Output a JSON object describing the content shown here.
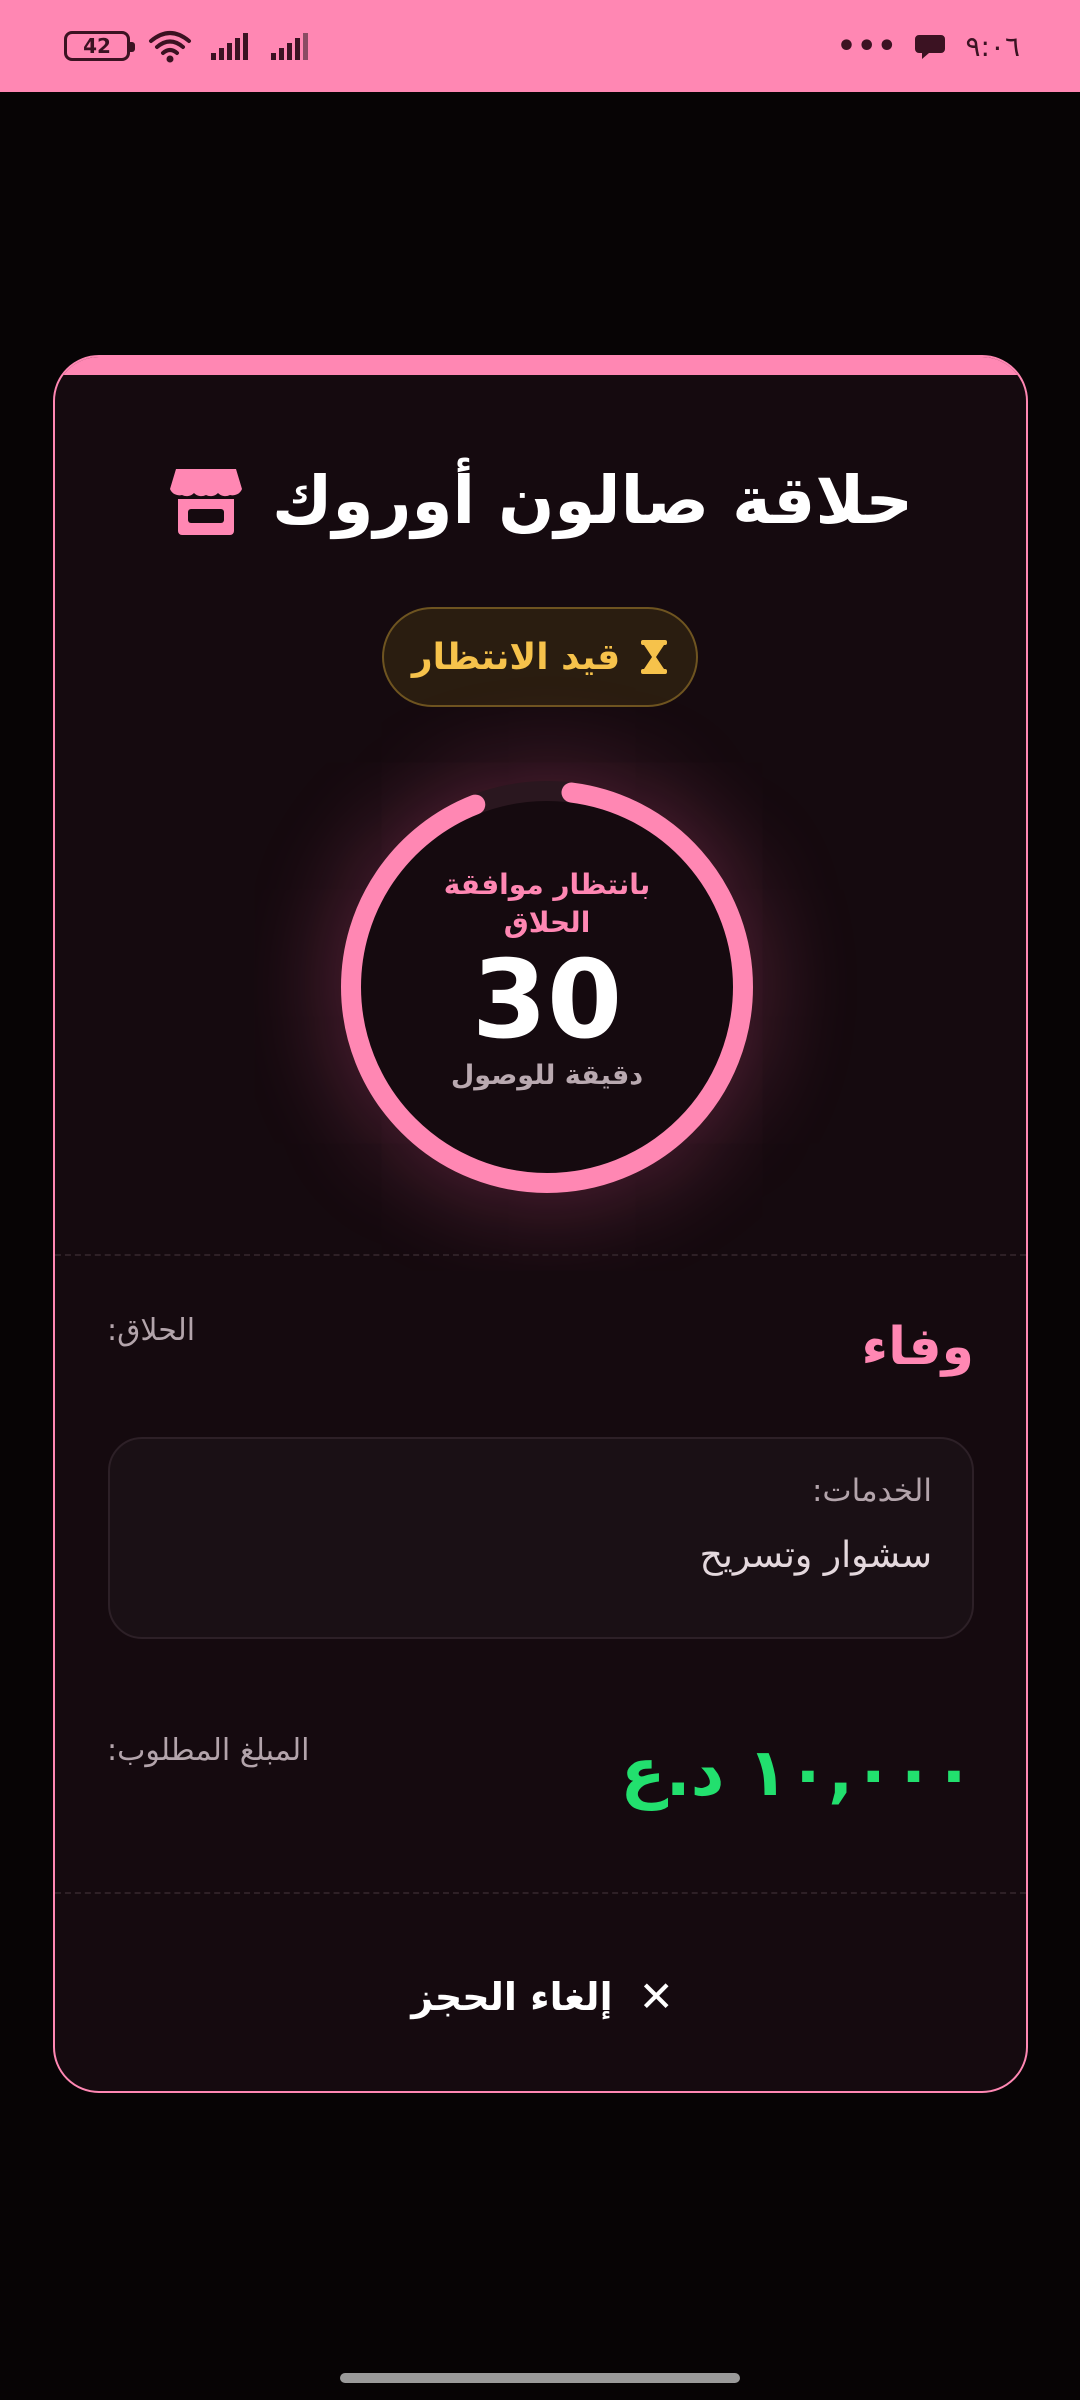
{
  "status_bar": {
    "time": "٩:٠٦",
    "battery": "42",
    "more": "•••",
    "icons": [
      "battery-icon",
      "wifi-icon",
      "signal-icon",
      "signal-icon",
      "message-icon"
    ]
  },
  "card": {
    "title": "حلاقة صالون أوروك",
    "title_icon": "store-icon",
    "status": "قيد الانتظار",
    "status_icon": "hourglass-icon",
    "ring": {
      "status_text": "بانتظار موافقة الحلاق",
      "minutes": "30",
      "unit_text": "دقيقة للوصول",
      "progress": 0.92
    },
    "barber_label": "الحلاق:",
    "barber_name": "وفاء",
    "services_label": "الخدمات:",
    "services_value": "سشوار وتسريح",
    "price_label": "المبلغ المطلوب:",
    "price_value": "١٠,٠٠٠ د.ع",
    "cancel_label": "إلغاء الحجز",
    "cancel_icon": "close-icon"
  },
  "colors": {
    "accent": "#ff87b3",
    "background": "#070405",
    "card": "#150a0f",
    "pending": "#f6c24b",
    "price": "#22e06e"
  }
}
